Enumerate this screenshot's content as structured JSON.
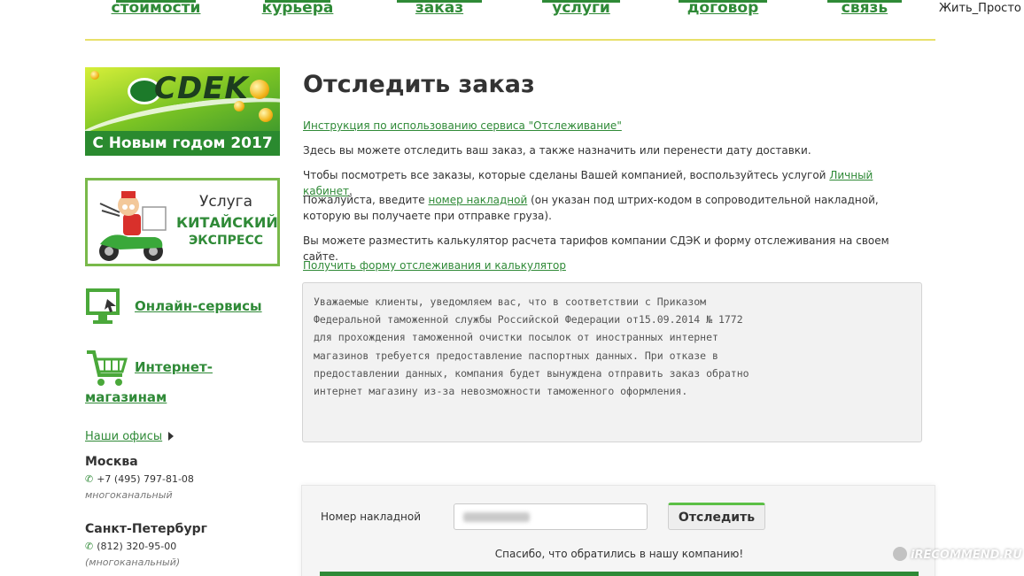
{
  "nav": {
    "items": [
      {
        "label": "стоимости"
      },
      {
        "label": "курьера"
      },
      {
        "label": "заказ"
      },
      {
        "label": "услуги"
      },
      {
        "label": "договор"
      },
      {
        "label": "связь"
      }
    ]
  },
  "overlay": {
    "top_right": "Жить_Просто",
    "bottom_right": "iRECOMMEND.RU"
  },
  "sidebar": {
    "promo": {
      "logo": "CDEK",
      "caption": "С Новым годом 2017"
    },
    "express": {
      "line1": "Услуга",
      "line2": "КИТАЙСКИЙ",
      "line3": "ЭКСПРЕСС"
    },
    "online_services": "Онлайн-сервисы",
    "online_shops": "Интернет-магазинам",
    "online_shops_l1": "Интернет-",
    "online_shops_l2": "магазинам",
    "offices_link": "Наши офисы",
    "offices": [
      {
        "city": "Москва",
        "phone": "+7 (495) 797-81-08",
        "note": "многоканальный"
      },
      {
        "city": "Санкт-Петербург",
        "phone": "(812) 320-95-00",
        "note": "(многоканальный)"
      }
    ]
  },
  "main": {
    "title": "Отследить заказ",
    "instruction_link": "Инструкция по использованию сервиса \"Отслеживание\"",
    "p1": "Здесь вы можете отследить ваш заказ, а также назначить или перенести дату доставки.",
    "p2_before": "Чтобы посмотреть все заказы, которые сделаны Вашей компанией, воспользуйтесь услугой ",
    "p2_link": "Личный кабинет",
    "p2_after": ".",
    "p3_before": "Пожалуйста, введите ",
    "p3_link": "номер накладной",
    "p3_after": " (он указан под штрих-кодом в сопроводительной накладной, которую вы получаете при отправке груза).",
    "p4": "Вы можете разместить калькулятор расчета тарифов компании СДЭК и форму отслеживания на своем сайте.",
    "form_link": "Получить форму отслеживания и калькулятор",
    "notice": "Уважаемые клиенты, уведомляем вас, что в соответствии с Приказом\nФедеральной таможенной службы Российской Федерации от15.09.2014 № 1772\nдля прохождения таможенной очистки посылок от иностранных интернет\nмагазинов требуется предоставление паспортных данных. При отказе в\nпредоставлении данных, компания будет вынуждена отправить заказ обратно\nинтернет магазину из-за невозможности таможенного оформления."
  },
  "tracking": {
    "label": "Номер накладной",
    "button": "Отследить",
    "thanks": "Спасибо, что обратились в нашу компанию!"
  },
  "colors": {
    "brand_green": "#2f8a37",
    "accent_yellow": "#e8e06a"
  }
}
